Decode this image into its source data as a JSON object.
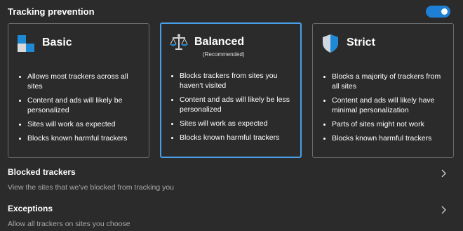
{
  "header": {
    "title": "Tracking prevention",
    "toggle_on": true
  },
  "colors": {
    "accent": "#1f7fd4",
    "selected_border": "#4aa0e8"
  },
  "cards": [
    {
      "name": "Basic",
      "subtitle": "",
      "icon": "basic-blocks-icon",
      "bullets": [
        "Allows most trackers across all sites",
        "Content and ads will likely be personalized",
        "Sites will work as expected",
        "Blocks known harmful trackers"
      ]
    },
    {
      "name": "Balanced",
      "subtitle": "(Recommended)",
      "icon": "balance-scale-icon",
      "selected": true,
      "bullets": [
        "Blocks trackers from sites you haven't visited",
        "Content and ads will likely be less personalized",
        "Sites will work as expected",
        "Blocks known harmful trackers"
      ]
    },
    {
      "name": "Strict",
      "subtitle": "",
      "icon": "shield-icon",
      "bullets": [
        "Blocks a majority of trackers from all sites",
        "Content and ads will likely have minimal personalization",
        "Parts of sites might not work",
        "Blocks known harmful trackers"
      ]
    }
  ],
  "sections": {
    "blocked": {
      "title": "Blocked trackers",
      "desc": "View the sites that we've blocked from tracking you"
    },
    "exceptions": {
      "title": "Exceptions",
      "desc": "Allow all trackers on sites you choose"
    }
  }
}
